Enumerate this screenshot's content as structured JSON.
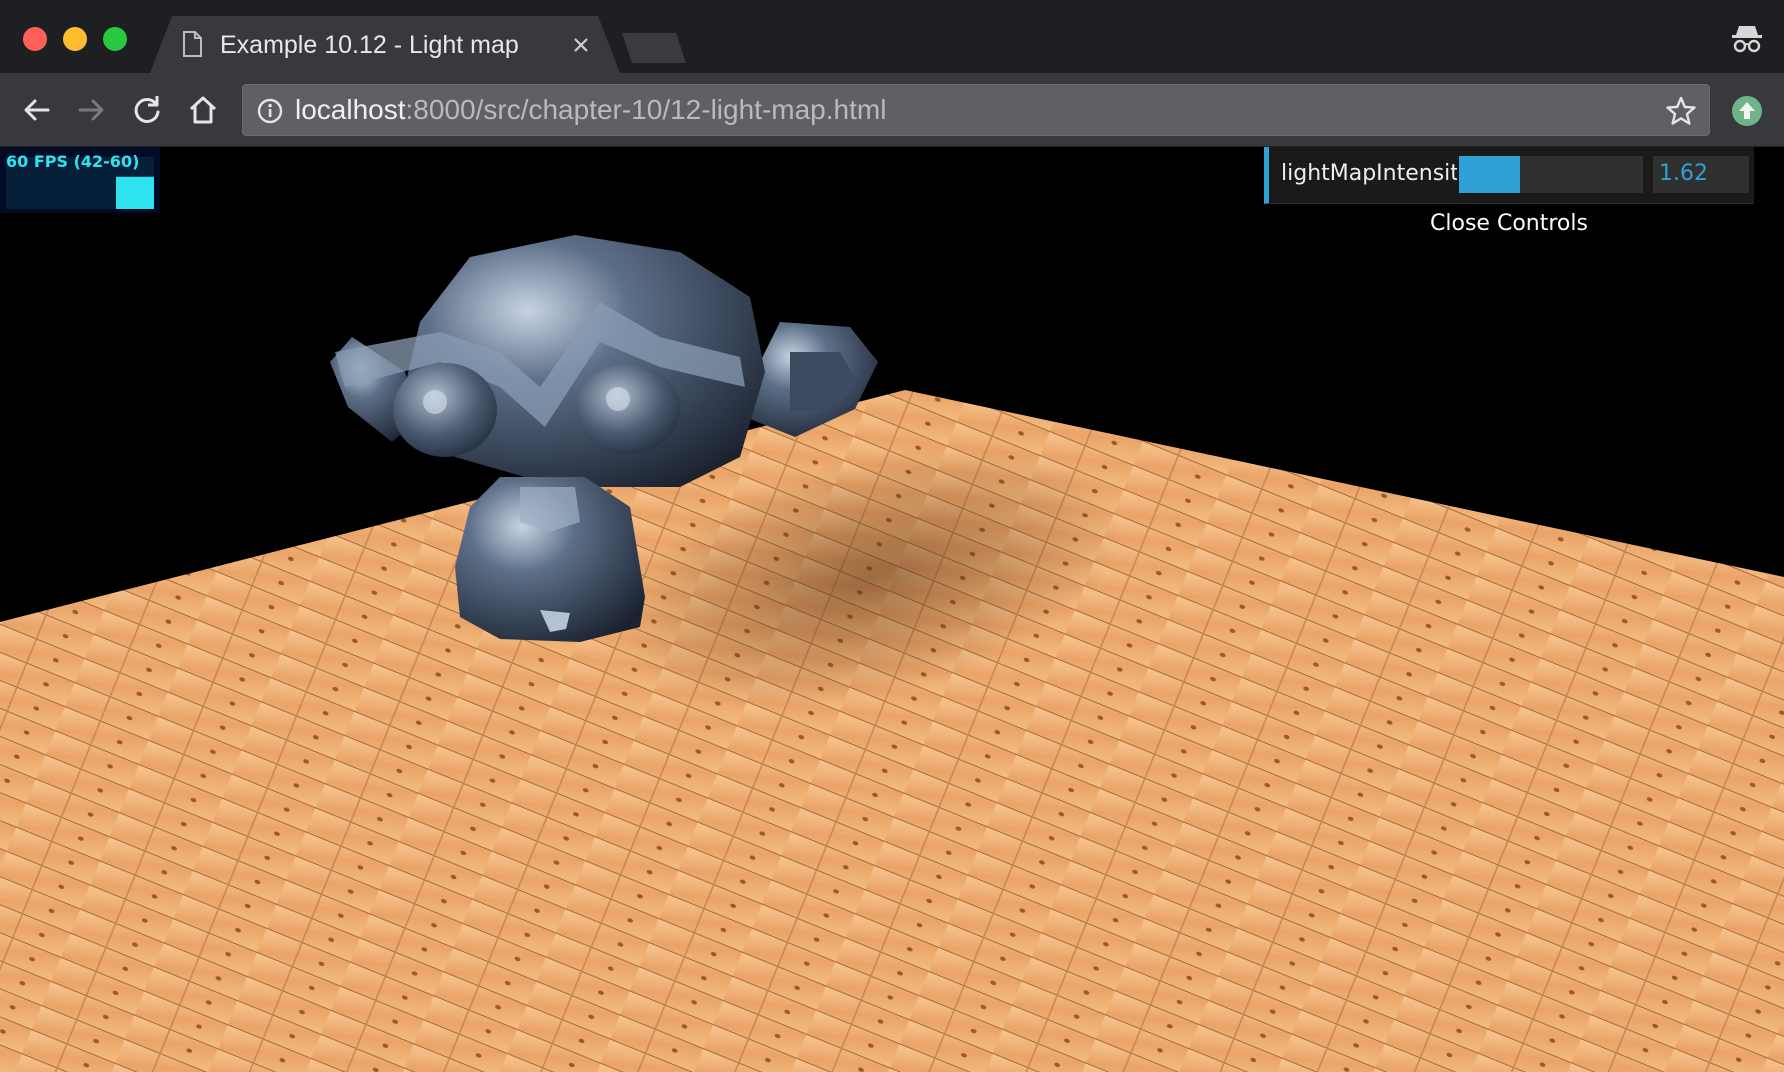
{
  "window": {
    "tab_title": "Example 10.12 - Light map",
    "url_host": "localhost",
    "url_rest": ":8000/src/chapter-10/12-light-map.html"
  },
  "stats": {
    "fps_label": "60 FPS (42-60)",
    "fps": 60,
    "fps_min": 42,
    "fps_max": 60,
    "color": "#2ee3f0"
  },
  "gui": {
    "controls": [
      {
        "name": "lightMapIntensity",
        "value": "1.62",
        "slider_fraction": 0.33
      }
    ],
    "close_label": "Close Controls",
    "accent": "#2fa1d6"
  },
  "scene": {
    "object": "monkey-head",
    "floor": "wooden-planks",
    "colors": {
      "wood": "#f4b070",
      "metal": "#5a6b80",
      "background": "#000000"
    }
  }
}
